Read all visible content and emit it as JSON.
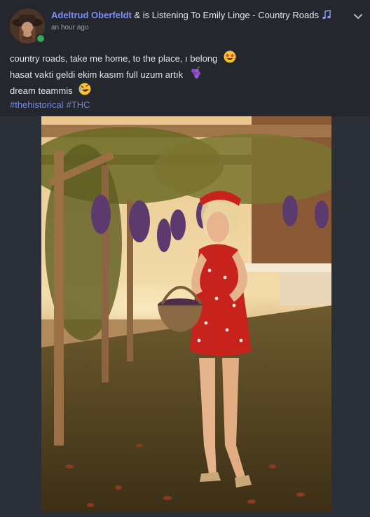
{
  "post": {
    "username": "Adeltrud Oberfeldt",
    "activity": " & is Listening To Emily Linge - Country Roads",
    "timestamp": "an hour ago",
    "lines": [
      "country roads, take me home, to the place, ı belong",
      "hasat vakti geldi ekim kasım full uzum artık",
      "dream teammis"
    ],
    "hashtags": [
      "#thehistorical",
      "#THC"
    ]
  },
  "colors": {
    "username": "#7c8cf7",
    "hashtag": "#6f86f0",
    "background": "#24272e",
    "online": "#3ba55d"
  },
  "icons": {
    "status": "online-dot",
    "activity": "music-note-icon",
    "menu": "chevron-down-icon",
    "line1": "star-struck-emoji",
    "line2": "grapes-emoji",
    "line3": "rolling-laughing-emoji"
  }
}
